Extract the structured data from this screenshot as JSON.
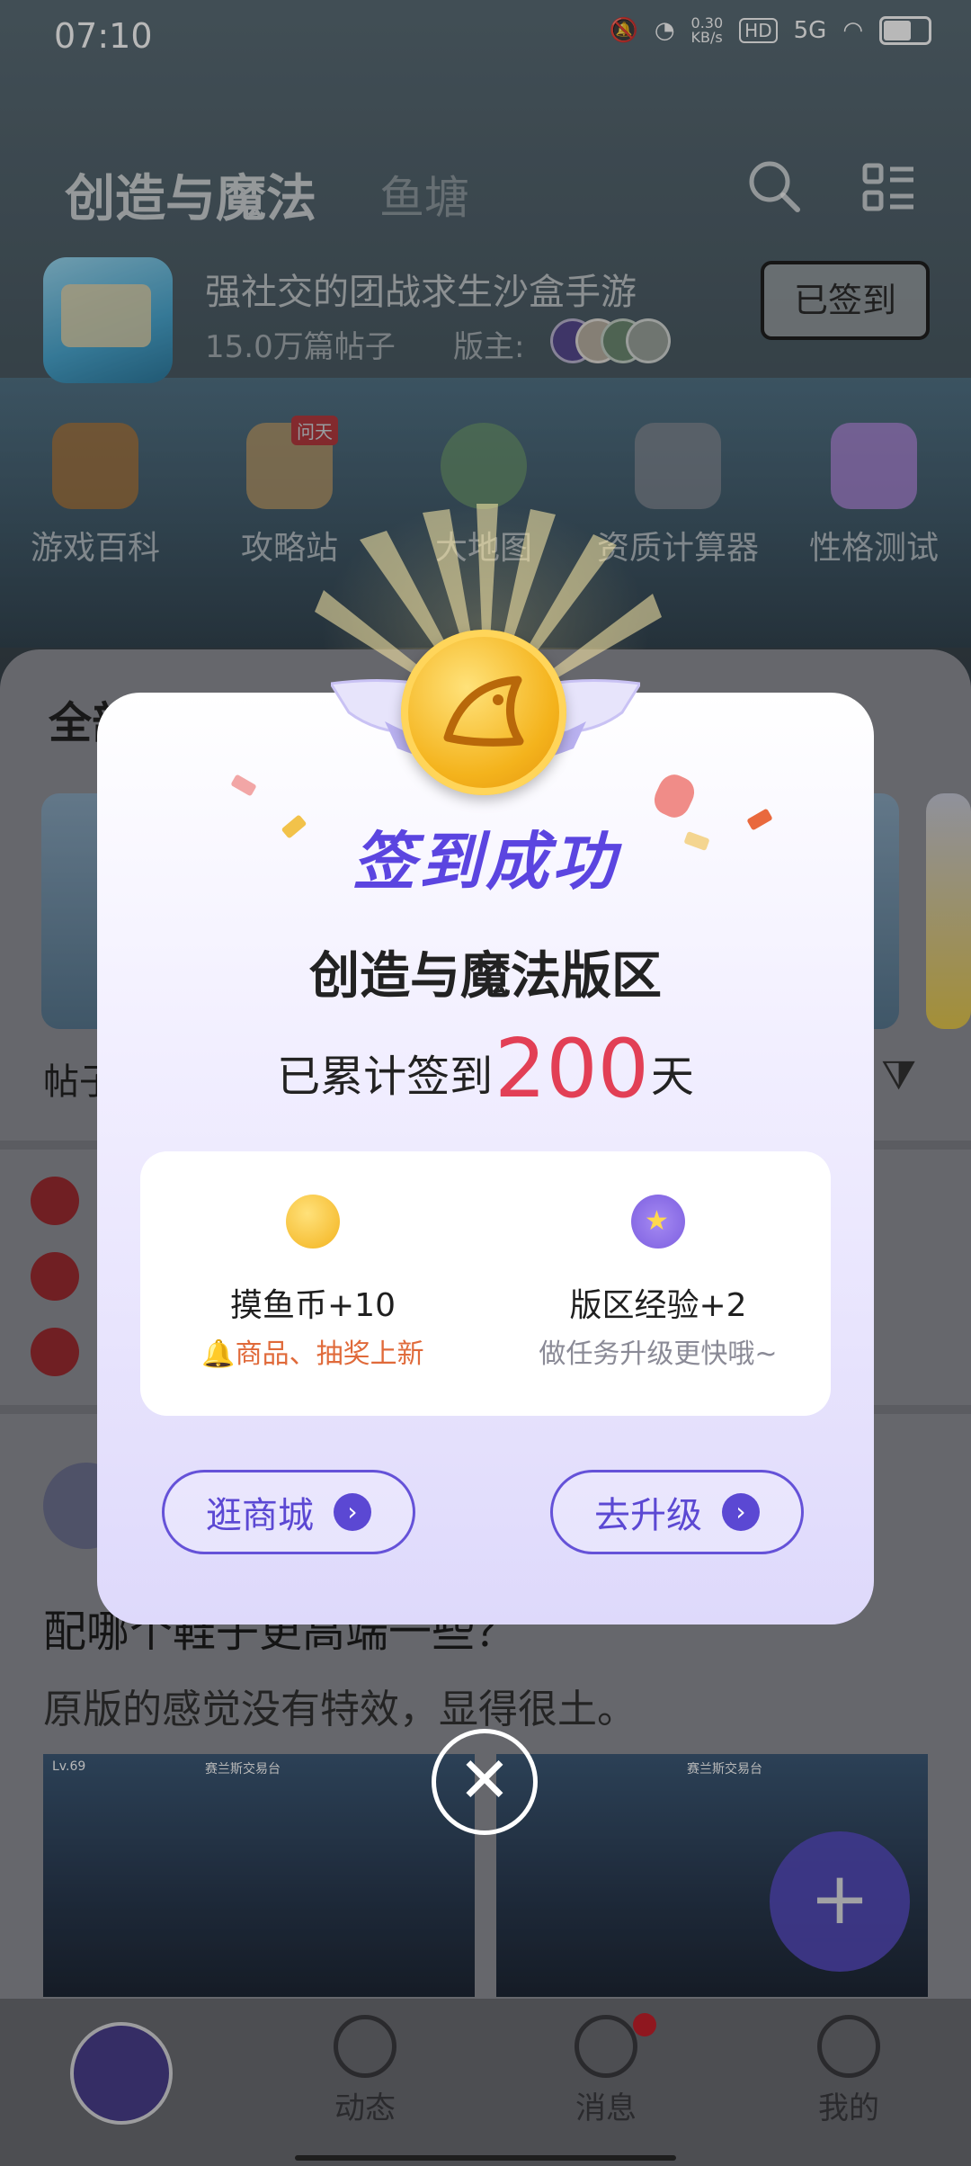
{
  "status_bar": {
    "time": "07:10",
    "net_speed": "0.30\nKB/s",
    "hd": "HD",
    "network": "5G"
  },
  "header": {
    "tab_main": "创造与魔法",
    "tab_sub": "鱼塘"
  },
  "forum": {
    "title": "强社交的团战求生沙盒手游",
    "posts": "15.0万篇帖子",
    "moderator_label": "版主:",
    "sign_status": "已签到"
  },
  "categories": [
    {
      "label": "游戏百科",
      "badge": ""
    },
    {
      "label": "攻略站",
      "badge": "问天"
    },
    {
      "label": "大地图",
      "badge": ""
    },
    {
      "label": "资质计算器",
      "badge": ""
    },
    {
      "label": "性格测试",
      "badge": ""
    }
  ],
  "sheet": {
    "tab_partial": "全部",
    "label_partial": "帖子"
  },
  "post": {
    "title": "配哪个鞋子更高端一些？",
    "body": "原版的感觉没有特效，显得很土。",
    "shot_caption": "赛兰斯交易台",
    "level": "Lv.69"
  },
  "bottom_nav": {
    "items": [
      "动态",
      "消息",
      "我的"
    ]
  },
  "dialog": {
    "success": "签到成功",
    "forum_name": "创造与魔法版区",
    "days_prefix": "已累计签到",
    "days": "200",
    "days_suffix": "天",
    "rewards": [
      {
        "title": "摸鱼币+10",
        "sub": "商品、抽奖上新",
        "icon": "fish-coin-icon"
      },
      {
        "title": "版区经验+2",
        "sub": "做任务升级更快哦~",
        "icon": "star-badge-icon"
      }
    ],
    "btn_shop": "逛商城",
    "btn_upgrade": "去升级"
  },
  "colors": {
    "accent": "#5b48d3",
    "days": "#e23f55",
    "reward_note": "#e06a3a"
  }
}
